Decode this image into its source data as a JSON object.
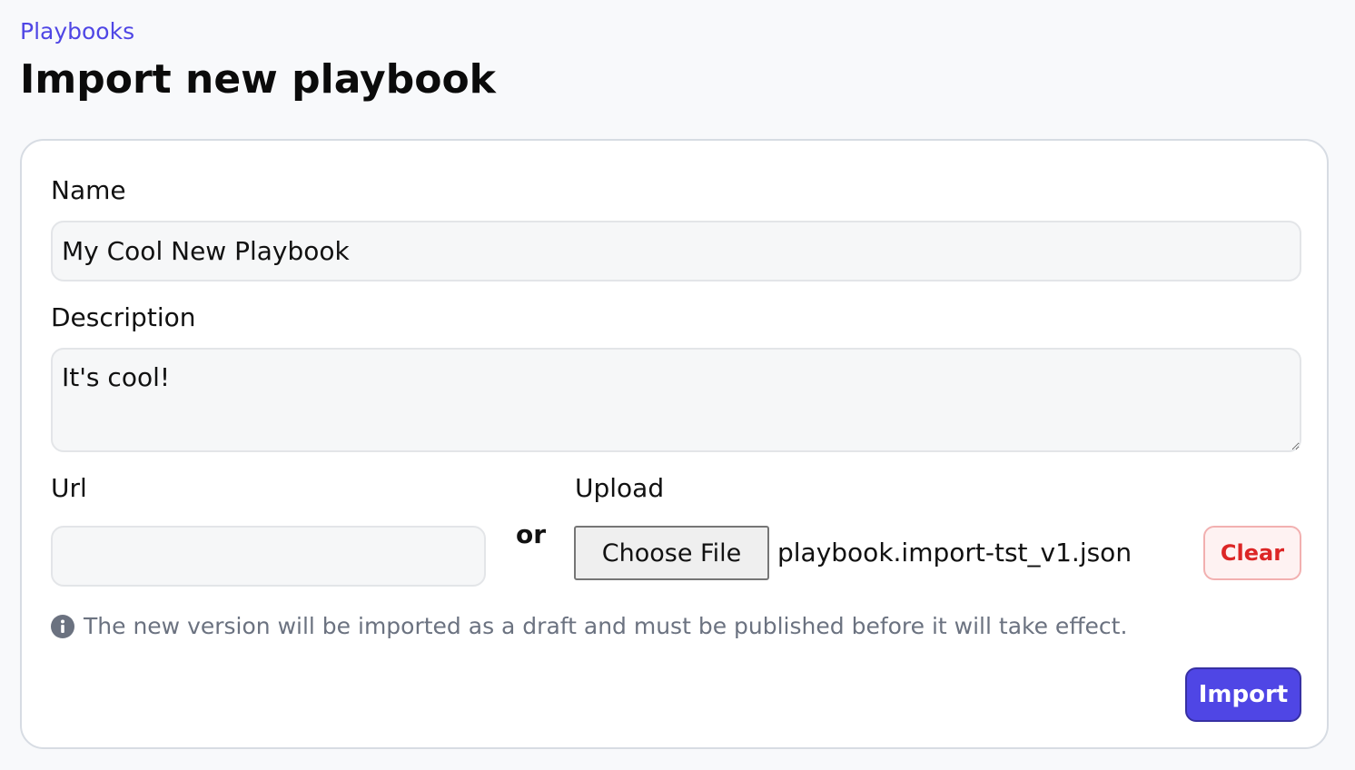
{
  "breadcrumb": {
    "label": "Playbooks"
  },
  "header": {
    "title": "Import new playbook"
  },
  "form": {
    "name": {
      "label": "Name",
      "value": "My Cool New Playbook"
    },
    "description": {
      "label": "Description",
      "value": "It's cool!"
    },
    "url": {
      "label": "Url",
      "value": ""
    },
    "separator": "or",
    "upload": {
      "label": "Upload",
      "choose_label": "Choose File",
      "file_name": "playbook.import-tst_v1.json",
      "clear_label": "Clear"
    },
    "info": {
      "icon": "info-icon",
      "text": "The new version will be imported as a draft and must be published before it will take effect."
    },
    "submit_label": "Import"
  },
  "colors": {
    "accent": "#4f46e5",
    "danger": "#dc2626",
    "muted": "#6b7280"
  }
}
